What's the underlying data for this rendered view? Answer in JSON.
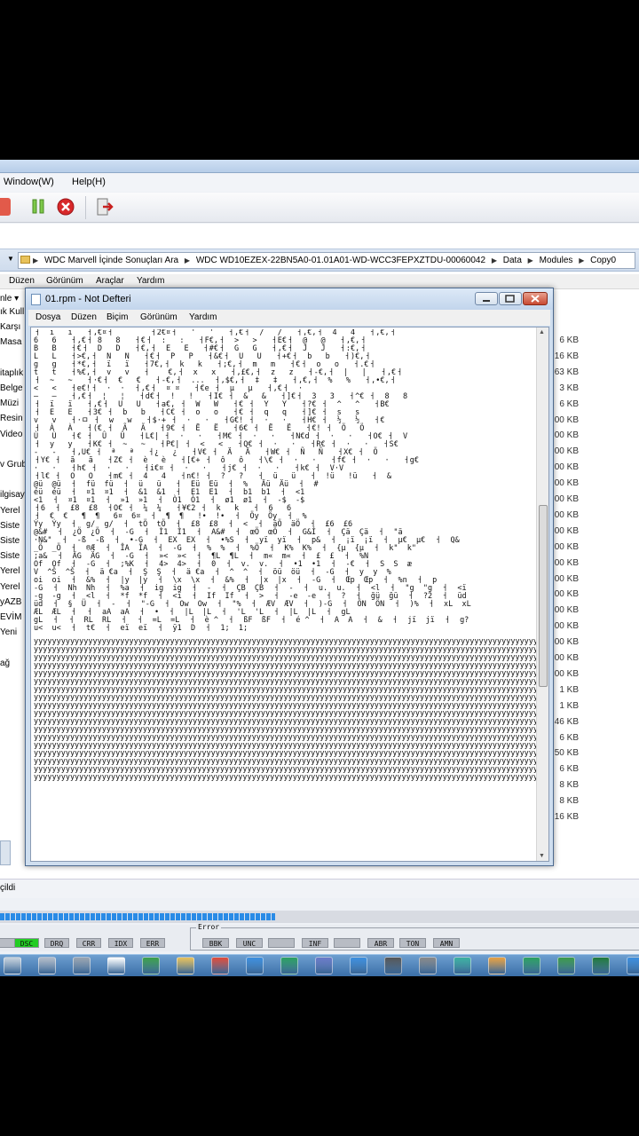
{
  "app": {
    "menu": [
      "Window(W)",
      "Help(H)"
    ]
  },
  "explorer": {
    "breadcrumb": [
      "WDC Marvell İçinde Sonuçları Ara",
      "WDC WD10EZEX-22BN5A0-01.01A01-WD-WCC3FEPXZTDU-00060042",
      "Data",
      "Modules",
      "Copy0"
    ],
    "menu": [
      "Düzen",
      "Görünüm",
      "Araçlar",
      "Yardım"
    ],
    "sidebar_items": [
      "nle ▾",
      "ık Kull",
      "Karşı",
      "Masa",
      "",
      "itaplık",
      "Belge",
      "Müzi",
      "Resin",
      "Video",
      "",
      "v Grub",
      "",
      "ilgisay",
      "Yerel",
      "Siste",
      "Siste",
      "Siste",
      "Yerel",
      "Yerel",
      "yAZB",
      "EVİM",
      "Yeni",
      "",
      "ağ"
    ],
    "sizes": [
      "6 KB",
      "16 KB",
      "63 KB",
      "3 KB",
      "6 KB",
      "00 KB",
      "00 KB",
      "00 KB",
      "00 KB",
      "00 KB",
      "00 KB",
      "00 KB",
      "00 KB",
      "00 KB",
      "00 KB",
      "00 KB",
      "00 KB",
      "00 KB",
      "00 KB",
      "00 KB",
      "00 KB",
      "00 KB",
      "1 KB",
      "1 KB",
      "46 KB",
      "6 KB",
      "50 KB",
      "6 KB",
      "8 KB",
      "8 KB",
      "16 KB"
    ],
    "status_text": "çildi"
  },
  "notepad": {
    "title": "01.rpm - Not Defteri",
    "menu": [
      "Dosya",
      "Düzen",
      "Biçim",
      "Görünüm",
      "Yardım"
    ],
    "content_binary": "ㅓ  ı   ı   ㅓ,€¤ㅓ        ㅓ2€¤ㅓ   '   '   ㅓ‚€ㅓ  /   /   ㅓ,€‚ㅓ  4   4   ㅓ‚€‚ㅓ\n6   6   ㅓ‚€ㅓ 8   8   ㅓ€ㅓ  :   :   ㅓF€‚ㅓ  >   >   ㅓE€ㅓ  @   @   ㅓ‚€‚ㅓ\nB   B   ㅓ€ㅓ  D   D   ㅓ€‚ㅓ  E   E   ㅓ#€ㅓ  G   G   ㅓ‚€ㅓ  J   J   ㅓ:€‚ㅓ\nL   L   ㅓ>€‚ㅓ  N   N   ㅓ€ㅓ  P   P   ㅓ&€ㅓ  U   U   ㅓ+€ㅓ  b   b   ㅓ)€‚ㅓ\ng   g   ㅓ*€‚ㅓ  ï   ï   ㅓ7€‚ㅓ  k   k   ㅓ;€‚ㅓ  m   m   ㅓ€ㅓ  o   o   ㅓ.€ㅓ\nt   t   ㅓ%€‚ㅓ  v   v   ㅓ    €‚ㅓ  x   x   ㅓ‚£€‚ㅓ  z   z   ㅓ-€‚ㅓ  |   |   ㅓ‚€ㅓ\nㅓ  ~   ~   ㅓ·€ㅓ  €   €   ㅓ-€‚ㅓ  ...  ㅓ‚$€‚ㅓ  ‡   ‡   ㅓ‚€‚ㅓ  %   %   ㅓ‚•€‚ㅓ\n<   <   ㅓe€!ㅓ  ·  ·  ㅓ‚€ㅓ  ¤ ¤   ㅓ€e ㅓ  µ   µ   ㅓ‚€ㅓ  ·\n—   —   ㅓ‚€ㅓ  ¦   ¦   ㅓd€ㅓ  !   !   ㅓI€ ㅓ  &   &   ㅓ]€ㅓ  3   3   ㅓ^€ ㅓ  8   8\nㅓ  ï   ï   ㅓ‚€ㅓ  U   U   ㅓa€‚ ㅓ  W   W   ㅓ€ ㅓ  Y   Y   ㅓ?€ ㅓ  ^   ^   ㅓB€\nㅓ  E   E   ㅓ3€ ㅓ  b   b   ㅓC€ ㅓ  o   o   ㅓ€ ㅓ  q   q   ㅓ]€ ㅓ  s   s\nv   v   ㅓ·ㅁ ㅓ  w   w   ㅓ$·+ ㅓ  ·   ·   ㅓG€! ㅓ  ·   ·   ㅓH€ ㅓ  ½   ½   ㅓ€\nㅓ  À   À   ㅓ(€ ㅓ  Ã   Ã   ㅓ9€ ㅓ  Ë   Ë   ㅓ6€ ㅓ  Ë   Ë   ㅓ€! ㅓ  Ö   Ö\nÙ   Ù   ㅓ€ ㅓ  Û   Û   ㅓL€| ㅓ  ·   ·   ㅓM€ ㅓ  ·   ·   ㅓN€d ㅓ  ·   ·   ㅓO€ ㅓ  V\nㅓ  y   y   ㅓK€ ㅓ  ~   ~   ㅓP€| ㅓ  <   <   ㅓQ€ ㅓ  ·   ·   ㅓR€ ㅓ  ·   ·   ㅓS€\n-   -   ㅓ‚U€ ㅓ  ª   ª   ㅓ¿   ¿   ㅓV€ ㅓ  Ä   Ä   ㅓW€ ㅓ  Ñ   Ñ   ㅓX€ ㅓ  Ö\nㅓY€ ㅓ  ã   ã   ㅓZ€ ㅓ  è   è   ㅓ[€+ ㅓ  ô   ô   ㅓ\\€ ㅓ  ·   ·   ㅓf€ ㅓ  ·   ·   ㅓg€\n·   ·   ㅓh€ ㅓ  ·   ·   ㅓi€¤ ㅓ  ·   ·   ㅓj€ ㅓ  ·   ·   ㅓk€ ㅓ  V·V\nㅓl€ ㅓ  O   O   ㅓm€ ㅓ  4   4   ㅓn€! ㅓ  ?   ?   ㅓ  ü   ü   ㅓ  !ü   !ü   ㅓ  &\n@ü  @ü  ㅓ  fü  fü  ㅓ  ü   ü   ㅓ  Eü  Eü  ㅓ  %   Äü  Äü  ㅓ  #\néü  éü  ㅓ  ¤1  ¤1  ㅓ  &1  &1  ㅓ  E1  E1  ㅓ  b1  b1  ㅓ  <1\n<1  ㅓ  ¤1  ¤1  ㅓ  »1  »1  ㅓ  Ò1  Ò1  ㅓ  ø1  ø1  ㅓ  -$  -$\nㅓ6  ㅓ  £8  £8  ㅓO€ ㅓ  ¼  ¼   ㅓ¥€2 ㅓ  k   k   ㅓ  6   6\nㅓ  €  €   ¶  ¶   6¤  6¤  ㅓ  ¶  ¶   !•  !•  ㅓ  Öy  Öy  ㅓ  %\nÝy  Ýy  ㅓ  g/  g/  ㅓ  tÖ  tÖ  ㅓ  £8  £8  ㅓ  <  ㅓ  äÖ  äÖ  ㅓ  £6  £6\n@&#  ㅓ  ¿Ö  ¿Ö  ㅓ  -G  ㅓ  Ì1  Ì1  ㅓ  A&#  ㅓ  œÖ  œÖ  ㅓ  G&Í  ㅓ  Çä  Çä  ㅓ  \"ä\n·N&\"  ㅓ  -ß  -ß  ㅓ  •-G  ㅓ  EX  EX  ㅓ  •%S  ㅓ  yï  yï  ㅓ  p&  ㅓ  ¡ï  ¡ï  ㅓ  µ€  µ€  ㅓ  Q&\n_Ö  _Ö  ㅓ  ®Æ  ㅓ  ÎA  ÎA  ㅓ  -G  ㅓ  %  %  ㅓ  %Ö  ㅓ  K%  K%  ㅓ  {µ  {µ  ㅓ  k\"  k\"\n;a&  ㅓ  ÄG  ÄG  ㅓ  -G  ㅓ  »<  »<  ㅓ  ¶L  ¶L  ㅓ  m«  m«  ㅓ  £  £  ㅓ  %N\nOf  Of  ㅓ  -G  ㅓ  ;%K  ㅓ  4>  4>  ㅓ  0  ㅓ  v.  v.  ㅓ  •1  •1  ㅓ  -€  ㅓ  S  S  æ\nV  ^Š  ^Š  ㅓ  ä €a  ㅓ  Ş  Ş  ㅓ  ä €a  ㅓ  ^  ^  ㅓ  öü  öü  ㅓ  -G  ㅓ  y  y  %\noi  oi  ㅓ  &%  ㅓ  |y  |y  ㅓ  \\x  \\x  ㅓ  &%  ㅓ  |x  |x  ㅓ  -G  ㅓ  Œp  Œp  ㅓ  %n  ㅓ  p\n-G  ㅓ  Nh  Nh  ㅓ  %a  ㅓ  ig  ig  ㅓ  -  ㅓ  ÇB  ÇB  ㅓ  -  ㅓ  u.  u.  ㅓ  <l  ㅓ  \"g  \"g  ㅓ  <ï\n-g  -g  ㅓ  <l  ㅓ  *f  *f  ㅓ  <ï  ㅓ  If  If  ㅓ  >  ㅓ  -e  -e  ㅓ  ?  ㅓ  ğü  ğü  ㅓ  ?2  ㅓ  üd\nüd  ㅓ  §  Ü  ㅓ  -  ㅓ  \"-G  ㅓ  Ow  Ow  ㅓ  \"%  ㅓ  ÆV  ÆV  ㅓ  )-G  ㅓ  ÖN  ÖN  ㅓ  )%  ㅓ  xL  xL\nÆL  ÆL  ㅓ  ㅓ  aA  aA  ㅓ  •  ㅓ  |L  |L  ㅓ  'L  'L  ㅓ  |L  |L  ㅓ  gL\ngL  ㅓ  ㅓ  RL  RL  ㅓ  ㅓ  =L  =L  ㅓ  è ^  ㅓ  ßF  ßF  ㅓ  é ^  ㅓ  A  A  ㅓ  &  ㅓ  jï  jï  ㅓ  g?\nu<  u<  ㅓ  t€  ㅓ  eï  eï  ㅓ  ÿ1  D  ㅓ  1;  1;",
    "content_fill": "yyyyyyyyyyyyyyyyyyyyyyyyyyyyyyyyyyyyyyyyyyyyyyyyyyyyyyyyyyyyyyyyyyyyyyyyyyyyyyyyyyyyyyyyyyyyyyyyyyyyyyyyyyyyyyyyyyyyyyyyyyyyyyyyyyyyyyy"
  },
  "indicators": {
    "group_label": "Error",
    "left": [
      "",
      "DSC",
      "DRQ",
      "CRR",
      "IDX",
      "ERR"
    ],
    "right": [
      "BBK",
      "UNC",
      "",
      "INF",
      "",
      "ABR",
      "TON",
      "AMN"
    ],
    "active_color": "#22cc22"
  },
  "progress": {
    "value_percent": 43
  },
  "taskbar": {
    "icons": [
      "network-icon",
      "drive-icon",
      "settings-icon",
      "cmd-icon",
      "add-icon",
      "folder-icon",
      "chrome-icon",
      "notepad-icon",
      "browser-icon",
      "user-icon",
      "tool-icon",
      "close-tool-icon",
      "gear-icon",
      "refresh-icon",
      "search-icon",
      "app-icon",
      "excel-icon",
      "excel-icon-2",
      "app-icon-2"
    ]
  }
}
